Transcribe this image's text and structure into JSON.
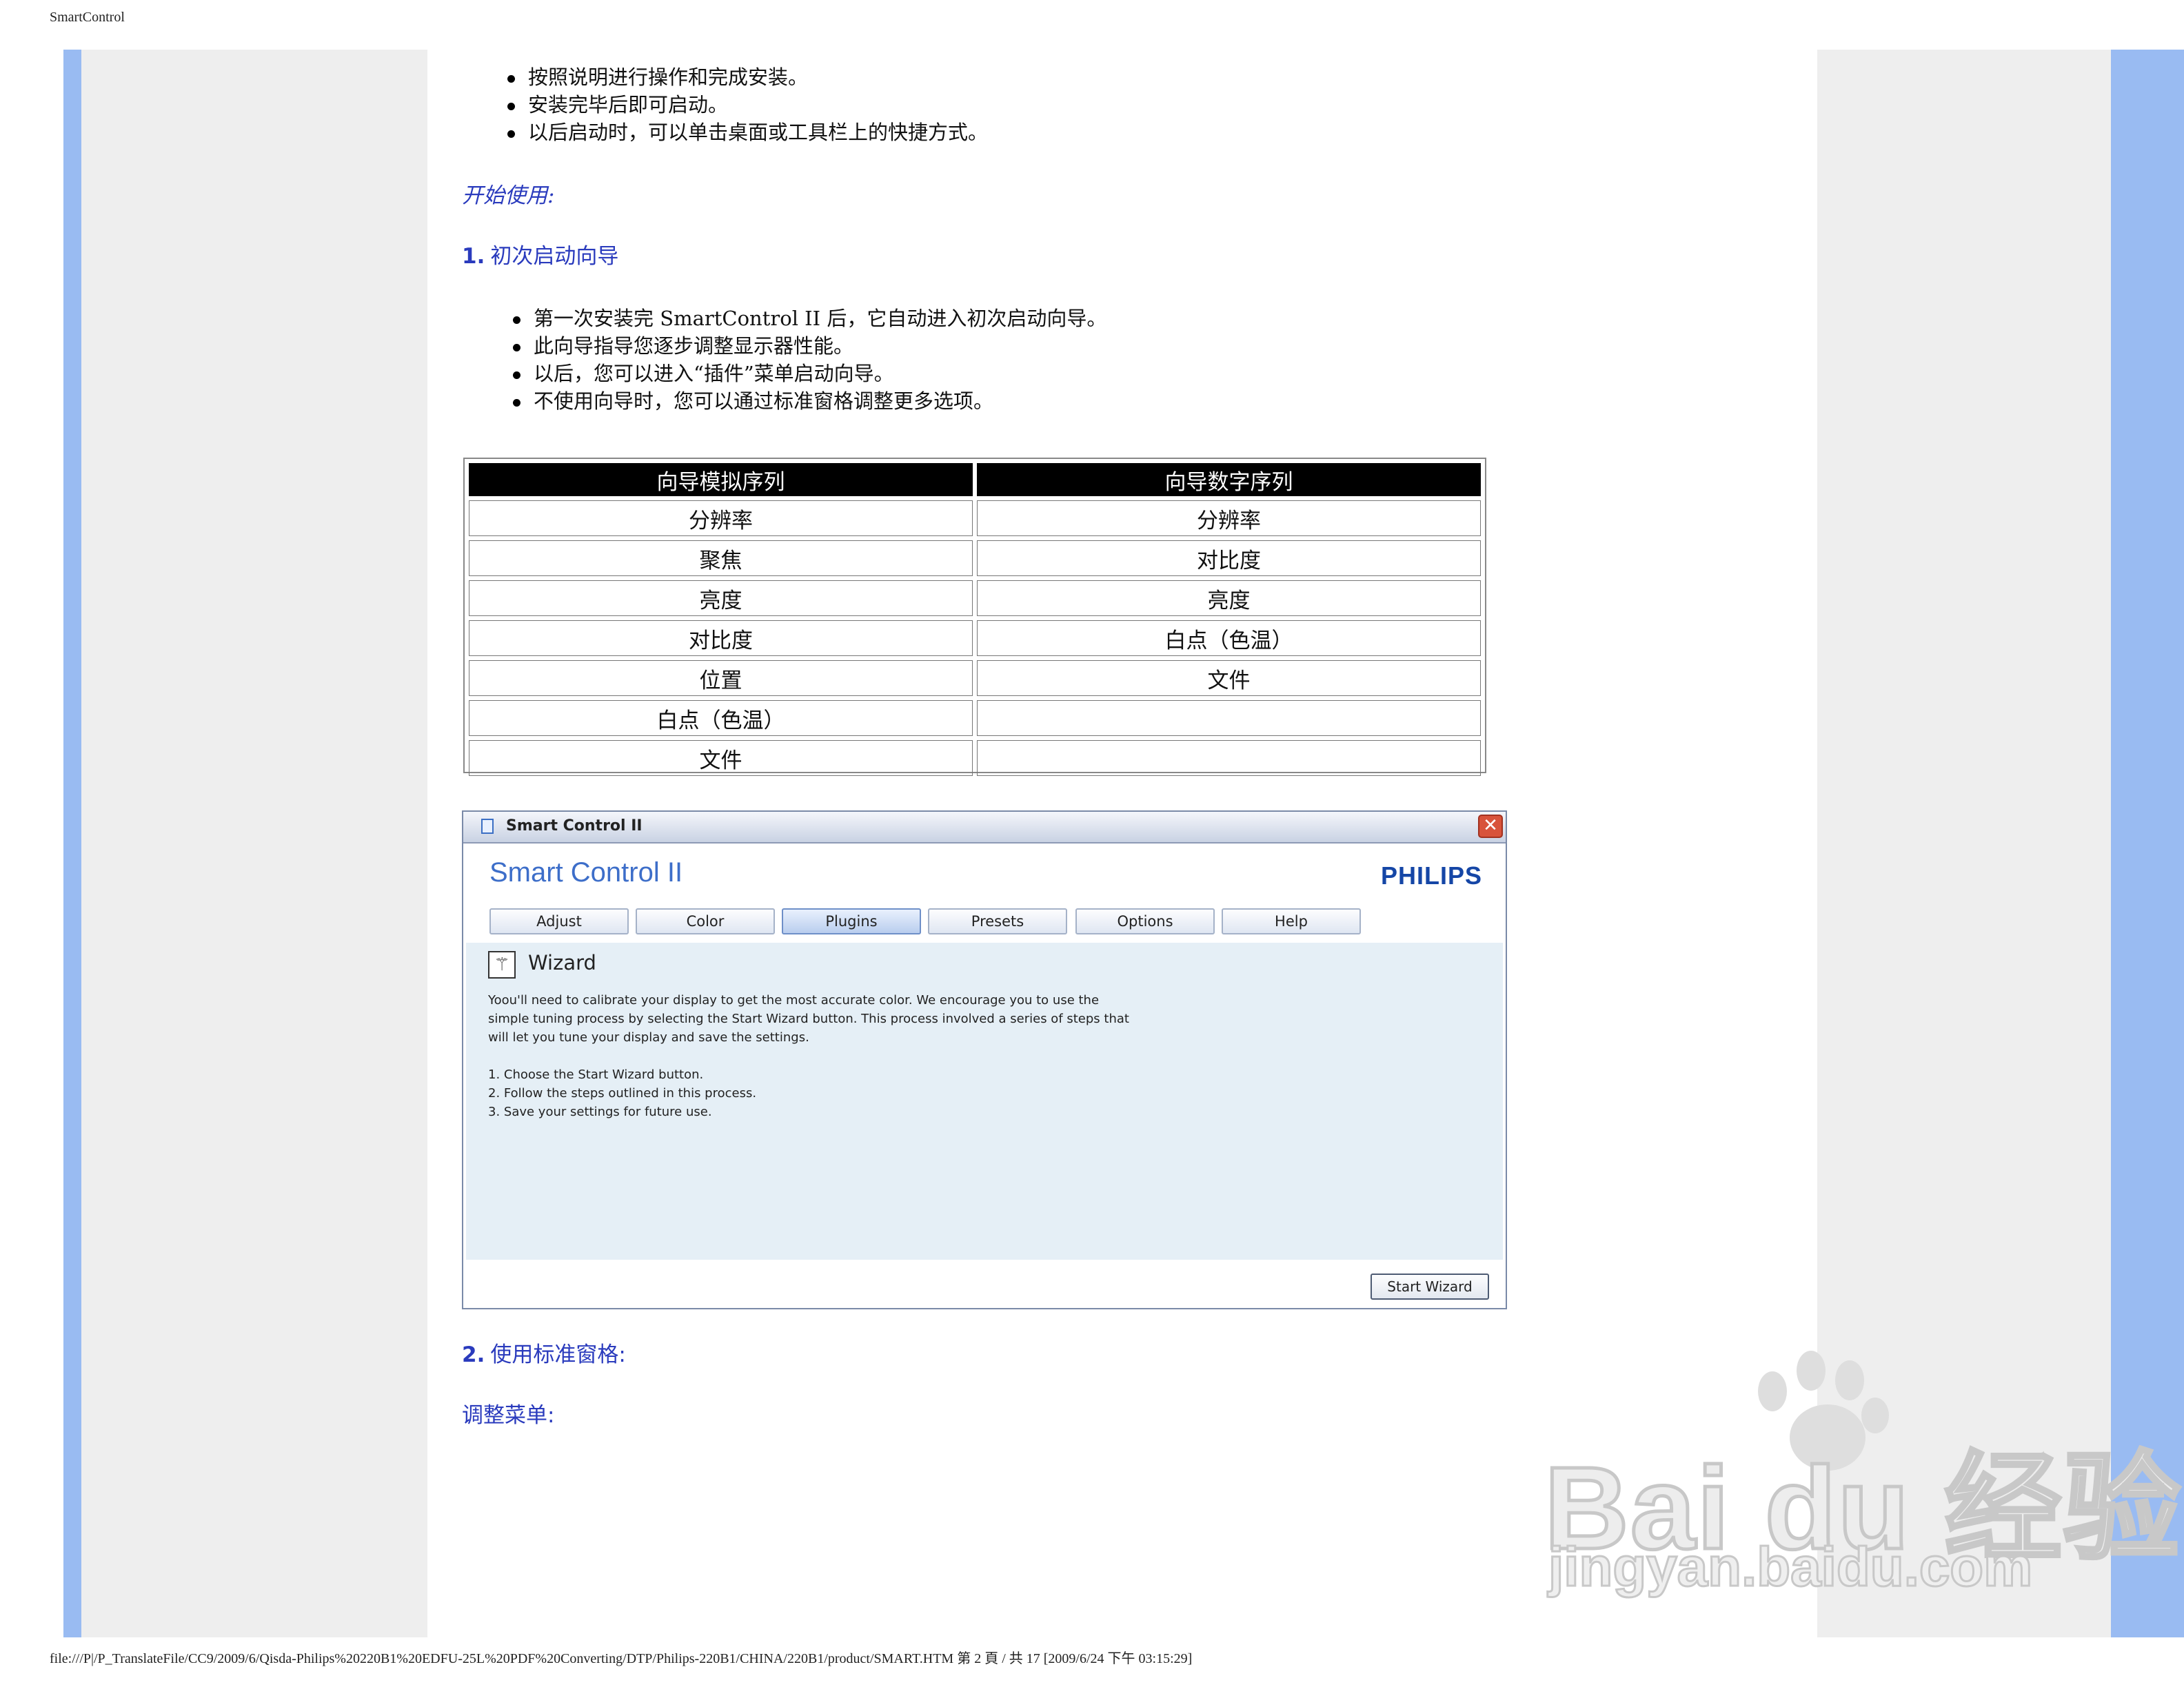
{
  "page": {
    "header_title": "SmartControl",
    "footer": "file:///P|/P_TranslateFile/CC9/2009/6/Qisda-Philips%20220B1%20EDFU-25L%20PDF%20Converting/DTP/Philips-220B1/CHINA/220B1/product/SMART.HTM 第 2 頁 / 共 17  [2009/6/24 下午 03:15:29]"
  },
  "install_bullets": [
    "按照说明进行操作和完成安装。",
    "安装完毕后即可启动。",
    "以后启动时，可以单击桌面或工具栏上的快捷方式。"
  ],
  "getting_started": "开始使用:",
  "section1": {
    "number": "1.",
    "title": "初次启动向导",
    "bullets": [
      "第一次安装完 SmartControl II 后，它自动进入初次启动向导。",
      "此向导指导您逐步调整显示器性能。",
      "以后，您可以进入“插件”菜单启动向导。",
      "不使用向导时，您可以通过标准窗格调整更多选项。"
    ]
  },
  "wizard_table": {
    "headers": [
      "向导模拟序列",
      "向导数字序列"
    ],
    "rows": [
      [
        "分辨率",
        "分辨率"
      ],
      [
        "聚焦",
        "对比度"
      ],
      [
        "亮度",
        "亮度"
      ],
      [
        "对比度",
        "白点（色温）"
      ],
      [
        "位置",
        "文件"
      ],
      [
        "白点（色温）",
        ""
      ],
      [
        "文件",
        ""
      ]
    ]
  },
  "smartcontrol_window": {
    "title": "Smart Control II",
    "brand": "Smart Control II",
    "logo": "PHILIPS",
    "active_tab": "Plugins",
    "tabs": [
      "Adjust",
      "Color",
      "Plugins",
      "Presets",
      "Options",
      "Help"
    ],
    "panel_title": "Wizard",
    "panel_icon": "wizard-wand-icon",
    "description": "Yoou'll need to calibrate your display to get the most accurate color. We encourage you to use the simple tuning process by selecting the Start Wizard button. This process involved a series of steps that will let you tune your display and save the settings.",
    "steps": [
      "1. Choose the Start Wizard button.",
      "2. Follow the steps outlined in this process.",
      "3. Save your settings for future use."
    ],
    "start_button": "Start Wizard",
    "close_icon": "close-icon"
  },
  "section2": {
    "number": "2.",
    "title": "使用标准窗格:"
  },
  "adjust_menu": "调整菜单:",
  "watermark": {
    "logo_text": "Bai du 经验",
    "url_text": "jingyan.baidu.com",
    "icon": "baidu-paw-icon"
  }
}
